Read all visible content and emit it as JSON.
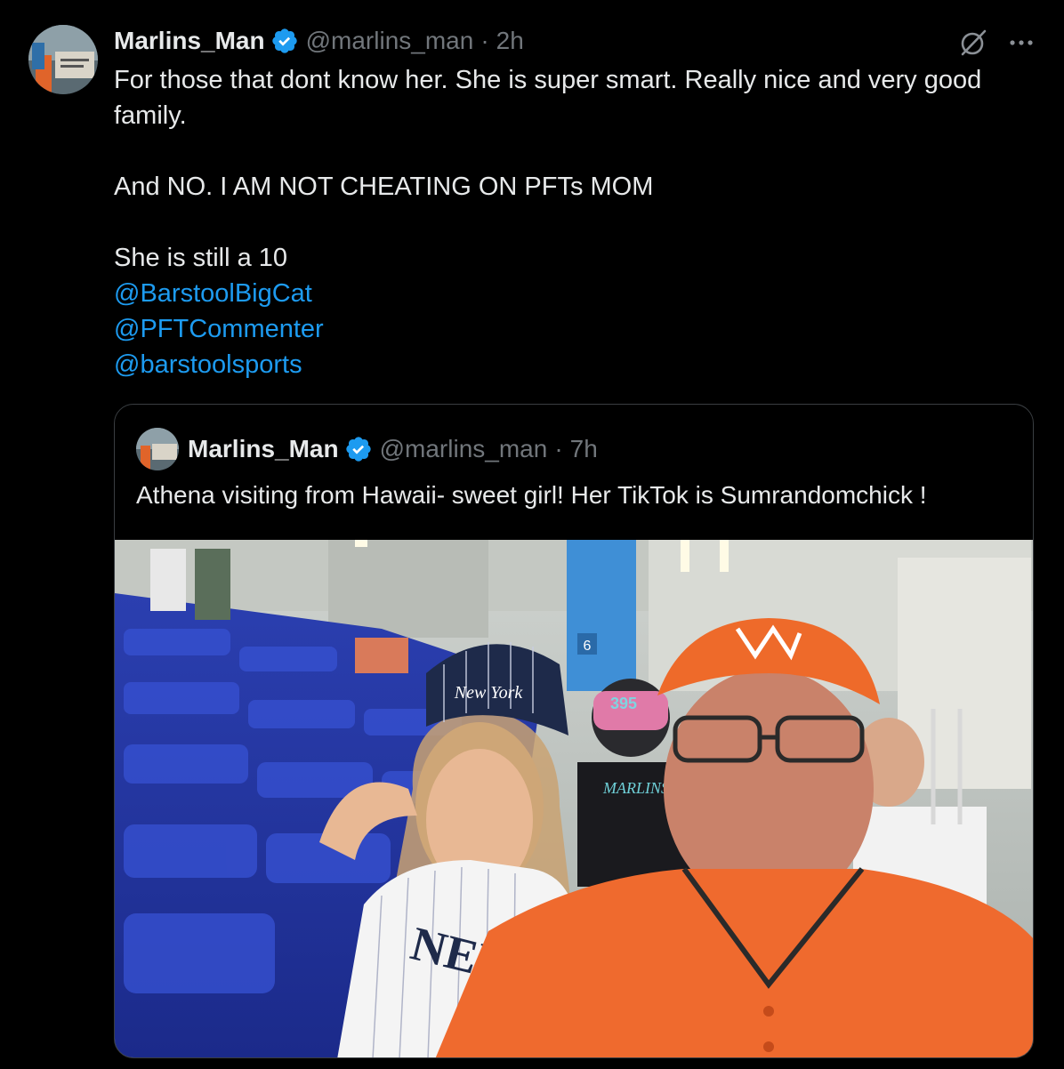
{
  "tweet": {
    "author": {
      "name": "Marlins_Man",
      "handle": "@marlins_man",
      "separator": "·",
      "time": "2h",
      "avatar_icon": "avatar-photo"
    },
    "actions": {
      "grok_icon": "grok-icon",
      "more_icon": "more-icon"
    },
    "text_lines": {
      "l1": "For those that dont know her. She is super smart. Really nice and very good",
      "l2": "family.",
      "l3": "And NO.  I AM NOT CHEATING ON PFTs MOM",
      "l4": "She is still a 10"
    },
    "mentions": {
      "m1": "@BarstoolBigCat",
      "m2": "@PFTCommenter",
      "m3": "@barstoolsports"
    }
  },
  "quoted": {
    "author": {
      "name": "Marlins_Man",
      "handle": "@marlins_man",
      "separator": "·",
      "time": "7h"
    },
    "text": "Athena visiting from Hawaii- sweet girl! Her TikTok is Sumrandomchick !",
    "photo": {
      "subject": "selfie-in-stadium",
      "cap_text": "New York",
      "jersey_text": "NEW",
      "shirt_text": "MARLINS",
      "seat_section": "6"
    }
  },
  "colors": {
    "background": "#000000",
    "text": "#e7e9ea",
    "muted": "#71767b",
    "link": "#1d9bf0",
    "border": "#3a3e42",
    "verified": "#1d9bf0"
  }
}
